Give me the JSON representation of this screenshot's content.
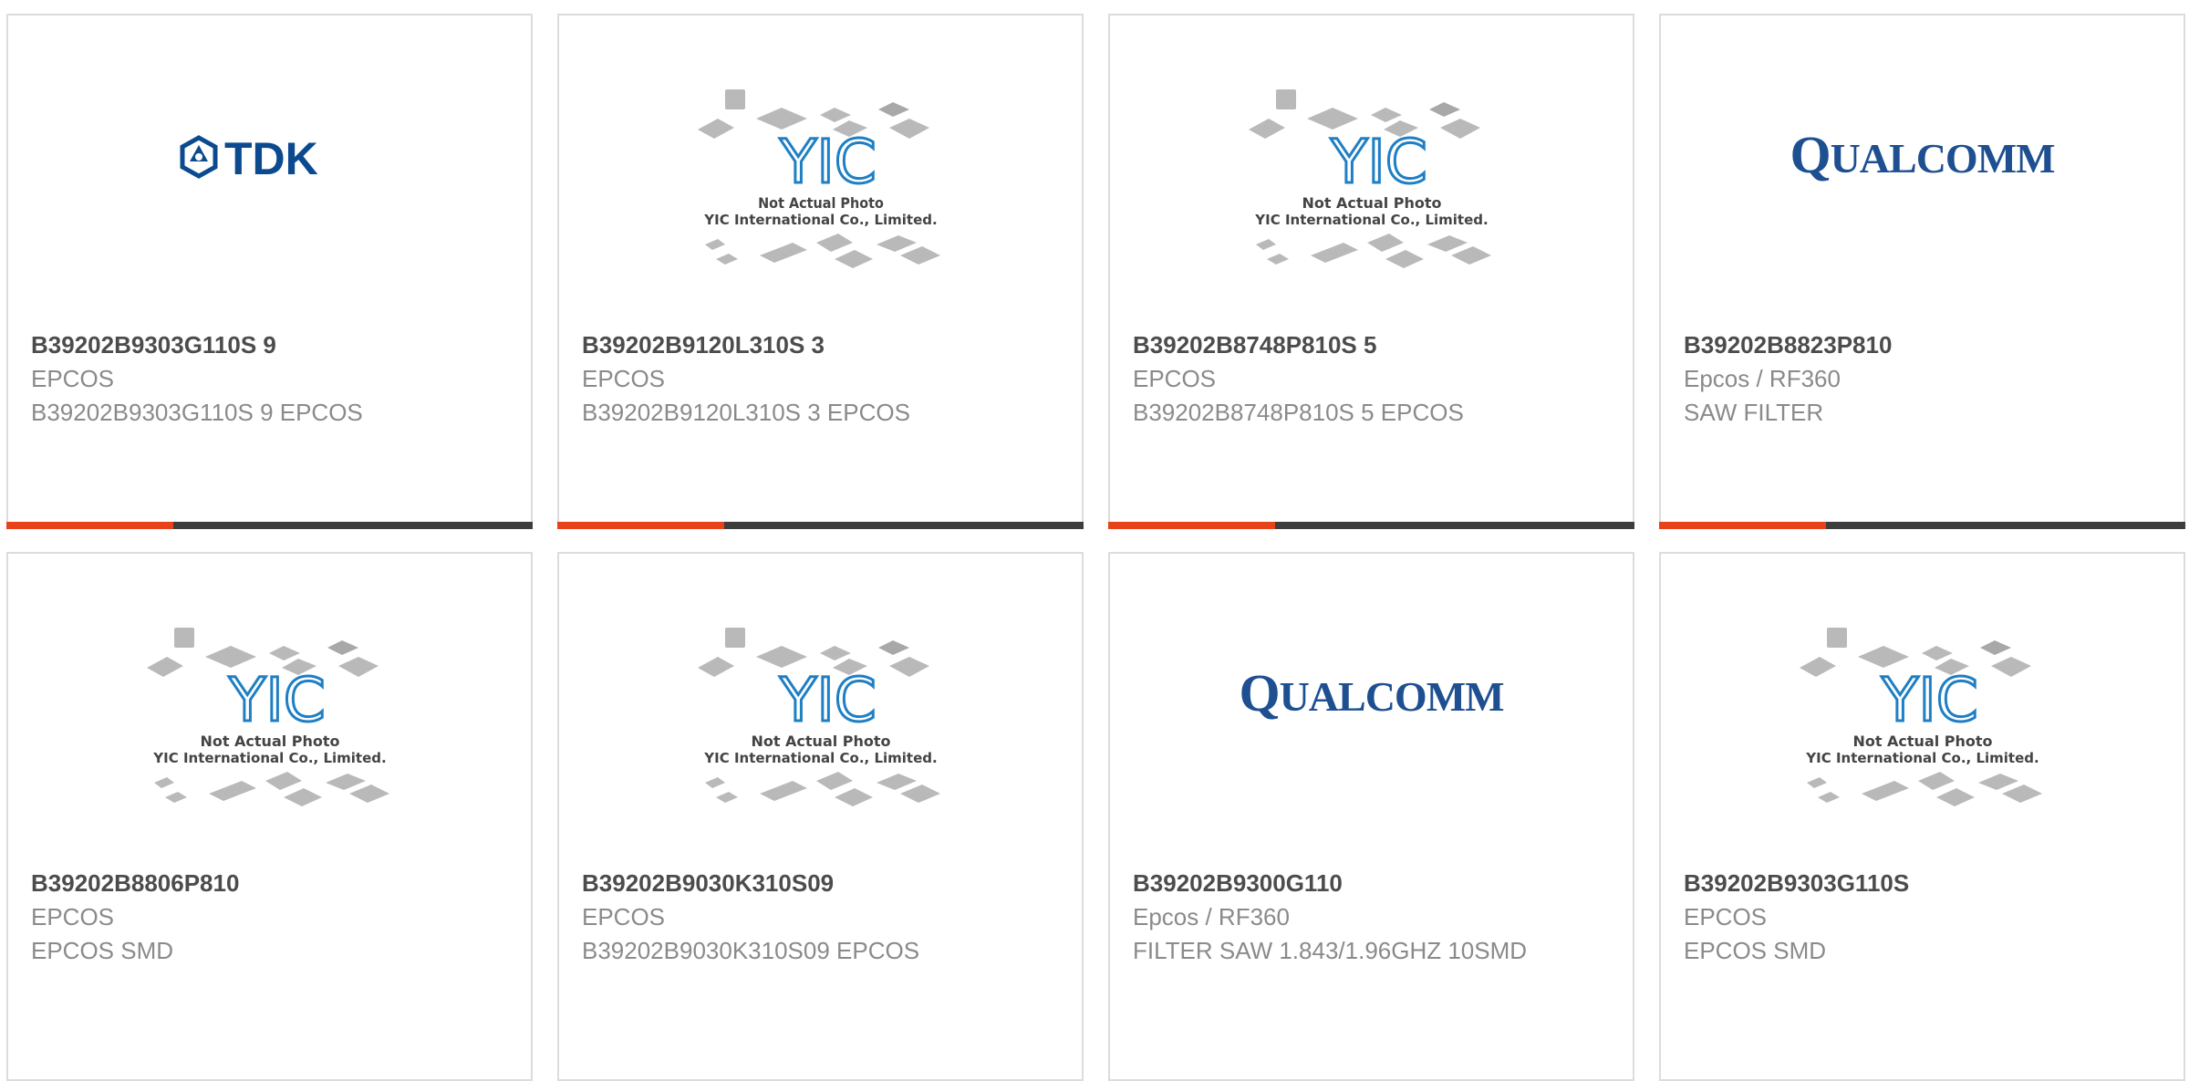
{
  "colors": {
    "accent": "#e8421b",
    "bar": "#3d3d3d",
    "yic_blue": "#1f7fc4",
    "tdk_blue": "#0b4a8f",
    "qualcomm_blue": "#1d4f91"
  },
  "placeholder": {
    "line1": "Not Actual Photo",
    "line2": "YIC International Co., Limited.",
    "logo_text": "YIC"
  },
  "logos": {
    "tdk": "TDK",
    "qualcomm_q": "Q",
    "qualcomm_rest": "UALCOMM"
  },
  "products": [
    {
      "image": "tdk-logo",
      "part": "B39202B9303G110S 9",
      "brand": "EPCOS",
      "desc": "B39202B9303G110S 9 EPCOS"
    },
    {
      "image": "yic-placeholder",
      "part": "B39202B9120L310S 3",
      "brand": "EPCOS",
      "desc": "B39202B9120L310S 3 EPCOS"
    },
    {
      "image": "yic-placeholder",
      "part": "B39202B8748P810S 5",
      "brand": "EPCOS",
      "desc": "B39202B8748P810S 5 EPCOS"
    },
    {
      "image": "qualcomm-logo",
      "part": "B39202B8823P810",
      "brand": "Epcos / RF360",
      "desc": "SAW FILTER"
    },
    {
      "image": "yic-placeholder",
      "part": "B39202B8806P810",
      "brand": "EPCOS",
      "desc": "EPCOS SMD"
    },
    {
      "image": "yic-placeholder",
      "part": "B39202B9030K310S09",
      "brand": "EPCOS",
      "desc": "B39202B9030K310S09 EPCOS"
    },
    {
      "image": "qualcomm-logo",
      "part": "B39202B9300G110",
      "brand": "Epcos / RF360",
      "desc": "FILTER SAW 1.843/1.96GHZ 10SMD"
    },
    {
      "image": "yic-placeholder",
      "part": "B39202B9303G110S",
      "brand": "EPCOS",
      "desc": "EPCOS SMD"
    }
  ]
}
